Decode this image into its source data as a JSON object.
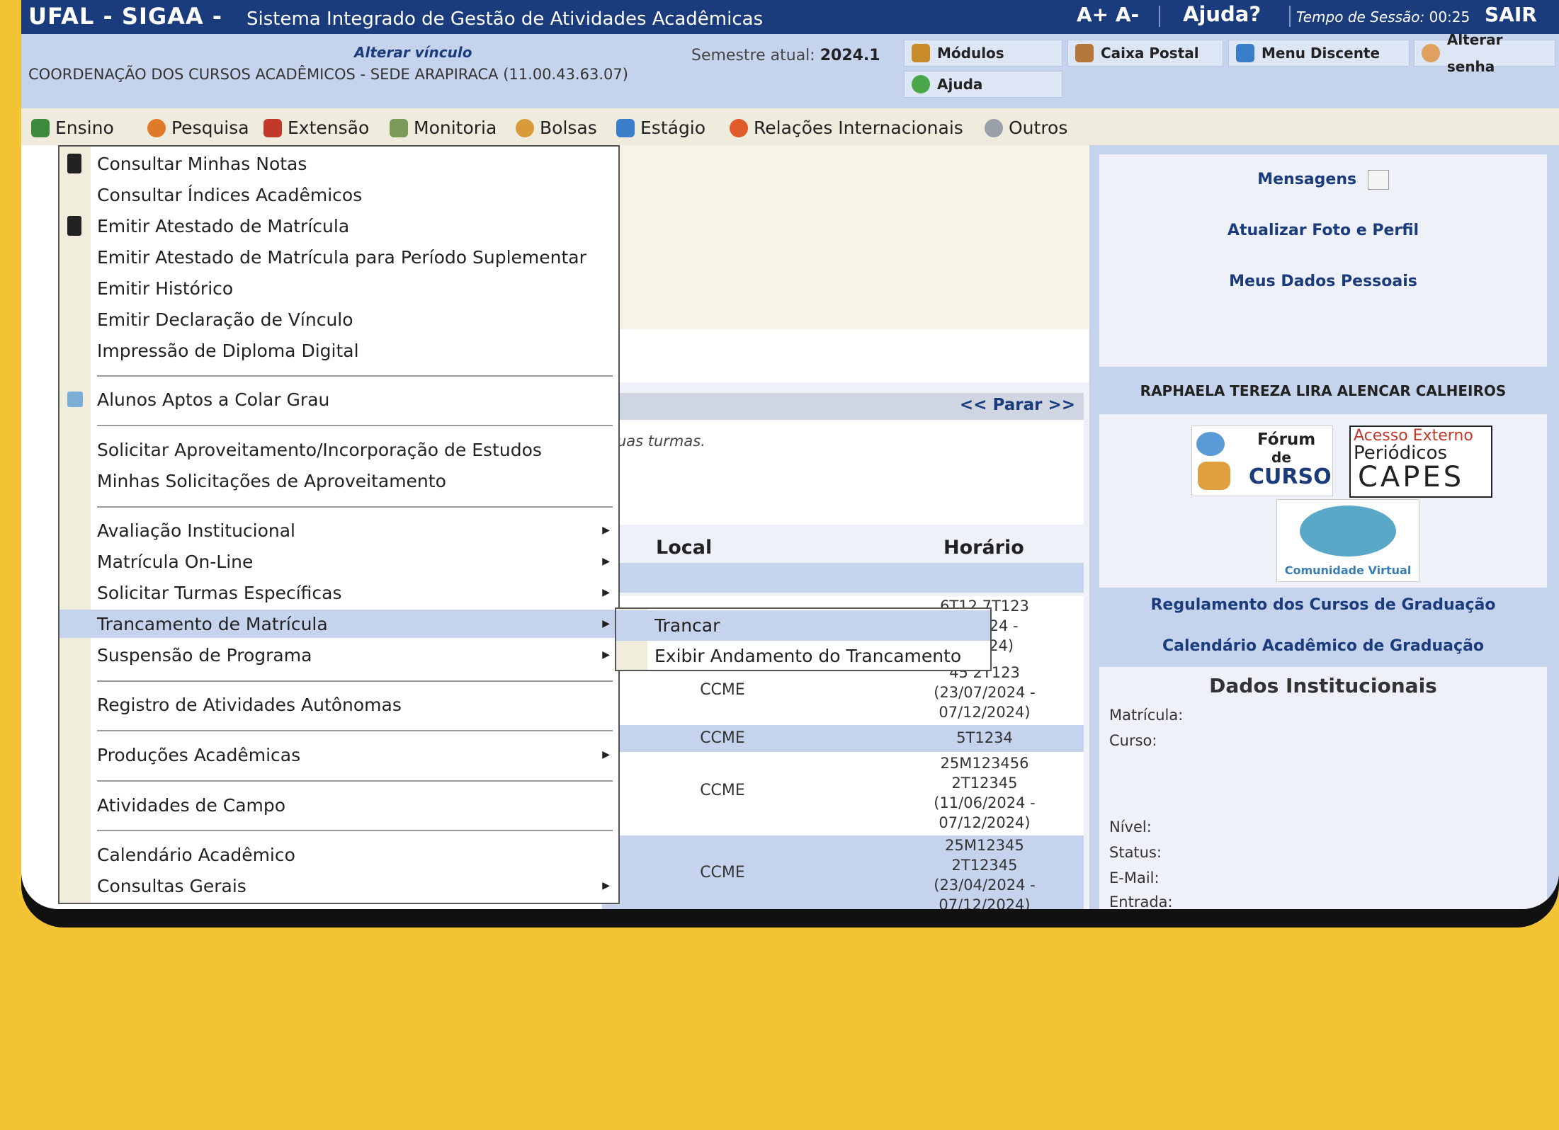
{
  "topbar": {
    "brand": "UFAL - SIGAA -",
    "subtitle": "Sistema Integrado de Gestão de Atividades Acadêmicas",
    "font_controls": "A+ A-",
    "help": "Ajuda?",
    "session_label": "Tempo de Sessão:",
    "session_time": "00:25",
    "logout": "SAIR"
  },
  "infobar": {
    "alter_link": "Alterar vínculo",
    "unit": "COORDENAÇÃO DOS CURSOS ACADÊMICOS - SEDE ARAPIRACA (11.00.43.63.07)",
    "semester_label": "Semestre atual:",
    "semester_value": "2024.1",
    "buttons": {
      "modules": "Módulos",
      "help": "Ajuda",
      "mailbox": "Caixa Postal",
      "student_menu": "Menu Discente",
      "change_password": "Alterar senha"
    }
  },
  "menubar": {
    "items": [
      "Ensino",
      "Pesquisa",
      "Extensão",
      "Monitoria",
      "Bolsas",
      "Estágio",
      "Relações Internacionais",
      "Outros"
    ]
  },
  "dropdown": {
    "items": [
      "Consultar Minhas Notas",
      "Consultar Índices Acadêmicos",
      "Emitir Atestado de Matrícula",
      "Emitir Atestado de Matrícula para Período Suplementar",
      "Emitir Histórico",
      "Emitir Declaração de Vínculo",
      "Impressão de Diploma Digital",
      "Alunos Aptos a Colar Grau",
      "Solicitar Aproveitamento/Incorporação de Estudos",
      "Minhas Solicitações de Aproveitamento",
      "Avaliação Institucional",
      "Matrícula On-Line",
      "Solicitar Turmas Específicas",
      "Trancamento de Matrícula",
      "Suspensão de Programa",
      "Registro de Atividades Autônomas",
      "Produções Acadêmicas",
      "Atividades de Campo",
      "Calendário Acadêmico",
      "Consultas Gerais"
    ],
    "submenu": [
      "Trancar",
      "Exibir Andamento do Trancamento"
    ]
  },
  "main": {
    "nav_parar": "<< Parar >>",
    "message_fragment": "suas turmas.",
    "col_local": "Local",
    "col_horario": "Horário",
    "rows": [
      {
        "local": "",
        "horario": [
          "6T12 7T123",
          "/4/2024 -",
          "2/2024)"
        ]
      },
      {
        "local": "CCME",
        "horario": [
          "45 2T123",
          "(23/07/2024 -",
          "07/12/2024)"
        ]
      },
      {
        "local": "CCME",
        "horario": [
          "5T1234"
        ]
      },
      {
        "local": "CCME",
        "horario": [
          "25M123456",
          "2T12345",
          "(11/06/2024 -",
          "07/12/2024)"
        ]
      },
      {
        "local": "CCME",
        "horario": [
          "25M12345",
          "2T12345",
          "(23/04/2024 -",
          "07/12/2024)"
        ]
      }
    ]
  },
  "sidebar": {
    "messages": "Mensagens",
    "update_photo": "Atualizar Foto e Perfil",
    "personal_data": "Meus Dados Pessoais",
    "student_name": "RAPHAELA TEREZA LIRA ALENCAR CALHEIROS",
    "forum_logo": {
      "line1": "Fórum",
      "line2": "de",
      "line3": "CURSO"
    },
    "capes_logo": {
      "line1": "Acesso Externo",
      "line2": "Periódicos",
      "line3": "CAPES"
    },
    "community_logo": "Comunidade Virtual",
    "regulation": "Regulamento dos Cursos de Graduação",
    "calendar": "Calendário Acadêmico de Graduação",
    "institutional_title": "Dados Institucionais",
    "labels": {
      "registration": "Matrícula:",
      "course": "Curso:",
      "level": "Nível:",
      "status": "Status:",
      "email": "E-Mail:",
      "entry": "Entrada:"
    }
  },
  "colors": {
    "page_background": "#f3c336",
    "topbar": "#1b3c7c",
    "infobar": "#c5d4ec",
    "menubar": "#efebdd"
  }
}
